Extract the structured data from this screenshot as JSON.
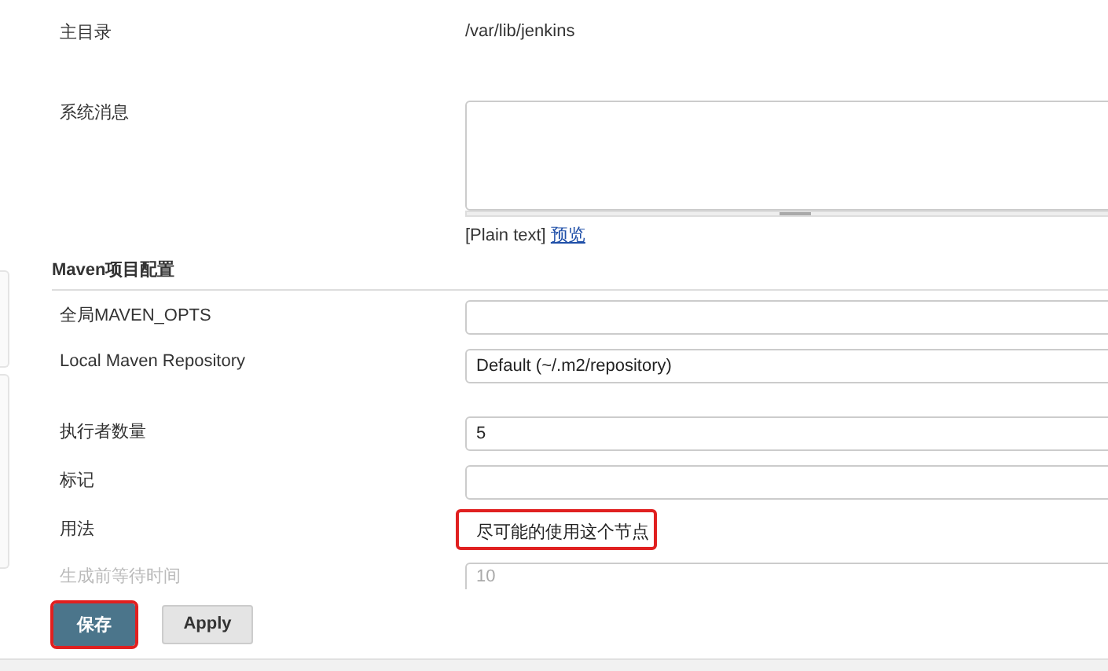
{
  "top_rows": [
    {
      "kind": "value",
      "label": "主目录",
      "value": "/var/lib/jenkins"
    },
    {
      "kind": "textarea",
      "label": "系统消息",
      "markup_note": "[Plain text]",
      "preview_link": "预览"
    }
  ],
  "section": {
    "title": "Maven项目配置",
    "rows": [
      {
        "kind": "text",
        "label": "全局MAVEN_OPTS",
        "highlighted": false
      },
      {
        "kind": "select",
        "label": "Local Maven Repository",
        "value": "Default (~/.m2/repository)",
        "highlighted": false
      },
      {
        "kind": "text",
        "label": "执行者数量",
        "value": "5",
        "highlighted": false
      },
      {
        "kind": "text",
        "label": "标记",
        "highlighted": false
      },
      {
        "kind": "select",
        "label": "用法",
        "value": "尽可能的使用这个节点",
        "highlighted": true
      },
      {
        "kind": "faded",
        "label": "生成前等待时间",
        "value": "10",
        "highlighted": false
      }
    ]
  },
  "buttons": [
    {
      "label": "保存",
      "kind": "primary",
      "highlighted": true
    },
    {
      "label": "Apply",
      "kind": "secondary",
      "highlighted": false
    }
  ]
}
